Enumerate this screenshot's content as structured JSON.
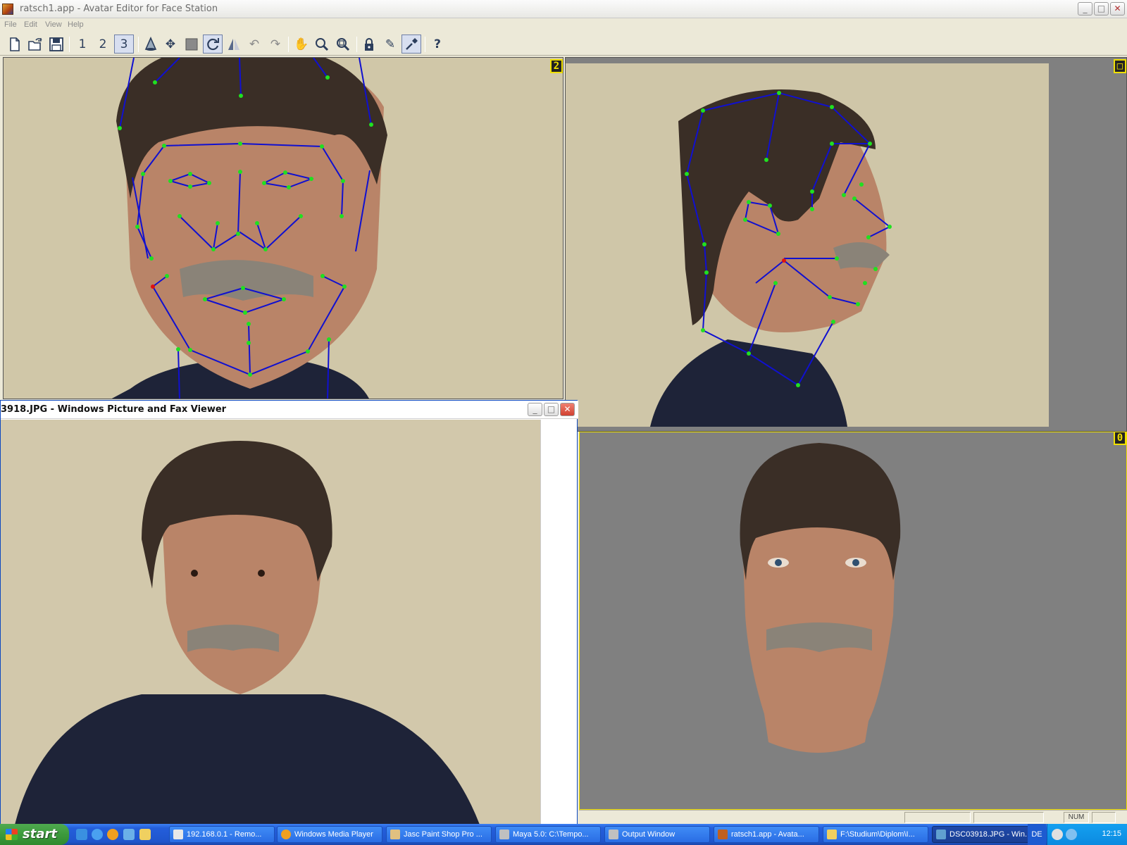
{
  "app": {
    "title": "ratsch1.app - Avatar Editor for Face Station",
    "controls": {
      "minimize": "_",
      "maximize": "□",
      "close": "✕"
    }
  },
  "menu": [
    "File",
    "Edit",
    "View",
    "Help"
  ],
  "toolbar": {
    "tools": [
      {
        "name": "new-file",
        "glyph": ""
      },
      {
        "name": "open-file",
        "glyph": ""
      },
      {
        "name": "save-file",
        "glyph": ""
      },
      {
        "name": "view-1",
        "glyph": "1"
      },
      {
        "name": "view-2",
        "glyph": "2"
      },
      {
        "name": "view-3",
        "glyph": "3"
      },
      {
        "name": "cone",
        "glyph": ""
      },
      {
        "name": "move",
        "glyph": "✥"
      },
      {
        "name": "square",
        "glyph": ""
      },
      {
        "name": "rotate",
        "glyph": ""
      },
      {
        "name": "mirror",
        "glyph": ""
      },
      {
        "name": "undo",
        "glyph": "↶"
      },
      {
        "name": "redo",
        "glyph": "↷"
      },
      {
        "name": "pan-hand",
        "glyph": "✋"
      },
      {
        "name": "zoom",
        "glyph": ""
      },
      {
        "name": "zoom-extents",
        "glyph": ""
      },
      {
        "name": "lock",
        "glyph": ""
      },
      {
        "name": "pencil",
        "glyph": "✎"
      },
      {
        "name": "pick",
        "glyph": ""
      },
      {
        "name": "help",
        "glyph": "?"
      }
    ]
  },
  "viewports": {
    "front": {
      "tag": "2"
    },
    "side": {
      "tag": "□"
    },
    "model": {
      "tag": "0"
    }
  },
  "viewer": {
    "title": "3918.JPG - Windows Picture and Fax Viewer",
    "controls": {
      "minimize": "_",
      "maximize": "□",
      "close": "✕"
    }
  },
  "statusbar": {
    "num": "NUM"
  },
  "taskbar": {
    "start": "start",
    "tasks": [
      "192.168.0.1 - Remo...",
      "Windows Media Player",
      "Jasc Paint Shop Pro ...",
      "Maya 5.0: C:\\Tempo...",
      "Output Window",
      "ratsch1.app - Avata...",
      "F:\\Studium\\Diplom\\I...",
      "DSC03918.JPG - Win..."
    ],
    "lang": "DE",
    "clock": "12:15"
  },
  "colors": {
    "wireframe": "#1010d0",
    "vertex": "#20e020",
    "selected_vertex": "#e01010",
    "wall": "#cfc6a8",
    "viewport_bg": "#808080",
    "active_border": "#f0e000"
  }
}
